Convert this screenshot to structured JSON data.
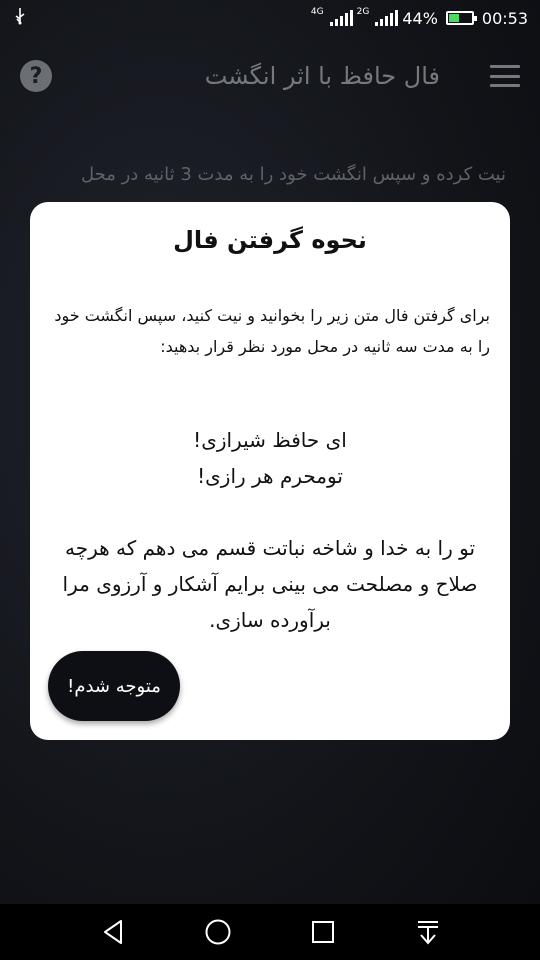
{
  "status_bar": {
    "usb_icon": "usb-icon",
    "net_4g": "4G",
    "net_2g": "2G",
    "battery_percent": "44%",
    "battery_level": 0.44,
    "time": "00:53"
  },
  "app_bar": {
    "help_icon": "help-icon",
    "help_glyph": "?",
    "title": "فال حافظ با اثر انگشت",
    "menu_icon": "menu-icon"
  },
  "background": {
    "instruction": "نیت کرده و سپس انگشت خود را به مدت 3 ثانیه در محل"
  },
  "dialog": {
    "title": "نحوه گرفتن فال",
    "body": "برای گرفتن فال متن زیر را بخوانید و نیت کنید، سپس انگشت خود را به مدت سه ثانیه در محل مورد نظر قرار بدهید:",
    "poem_line1": "ای حافظ شیرازی!",
    "poem_line2": "تومحرم هر رازی!",
    "prayer": "تو را به خدا و شاخه نباتت قسم می دهم که هرچه صلاح و مصلحت می بینی برایم آشکار و آرزوی مرا برآورده سازی.",
    "ok_label": "متوجه شدم!"
  },
  "nav_bar": {
    "items": [
      "back-icon",
      "home-icon",
      "recents-icon",
      "notification-pull-icon"
    ]
  },
  "colors": {
    "background": "#121419",
    "dialog": "#ffffff",
    "button": "#0e0f14",
    "muted_text": "#75787c"
  }
}
